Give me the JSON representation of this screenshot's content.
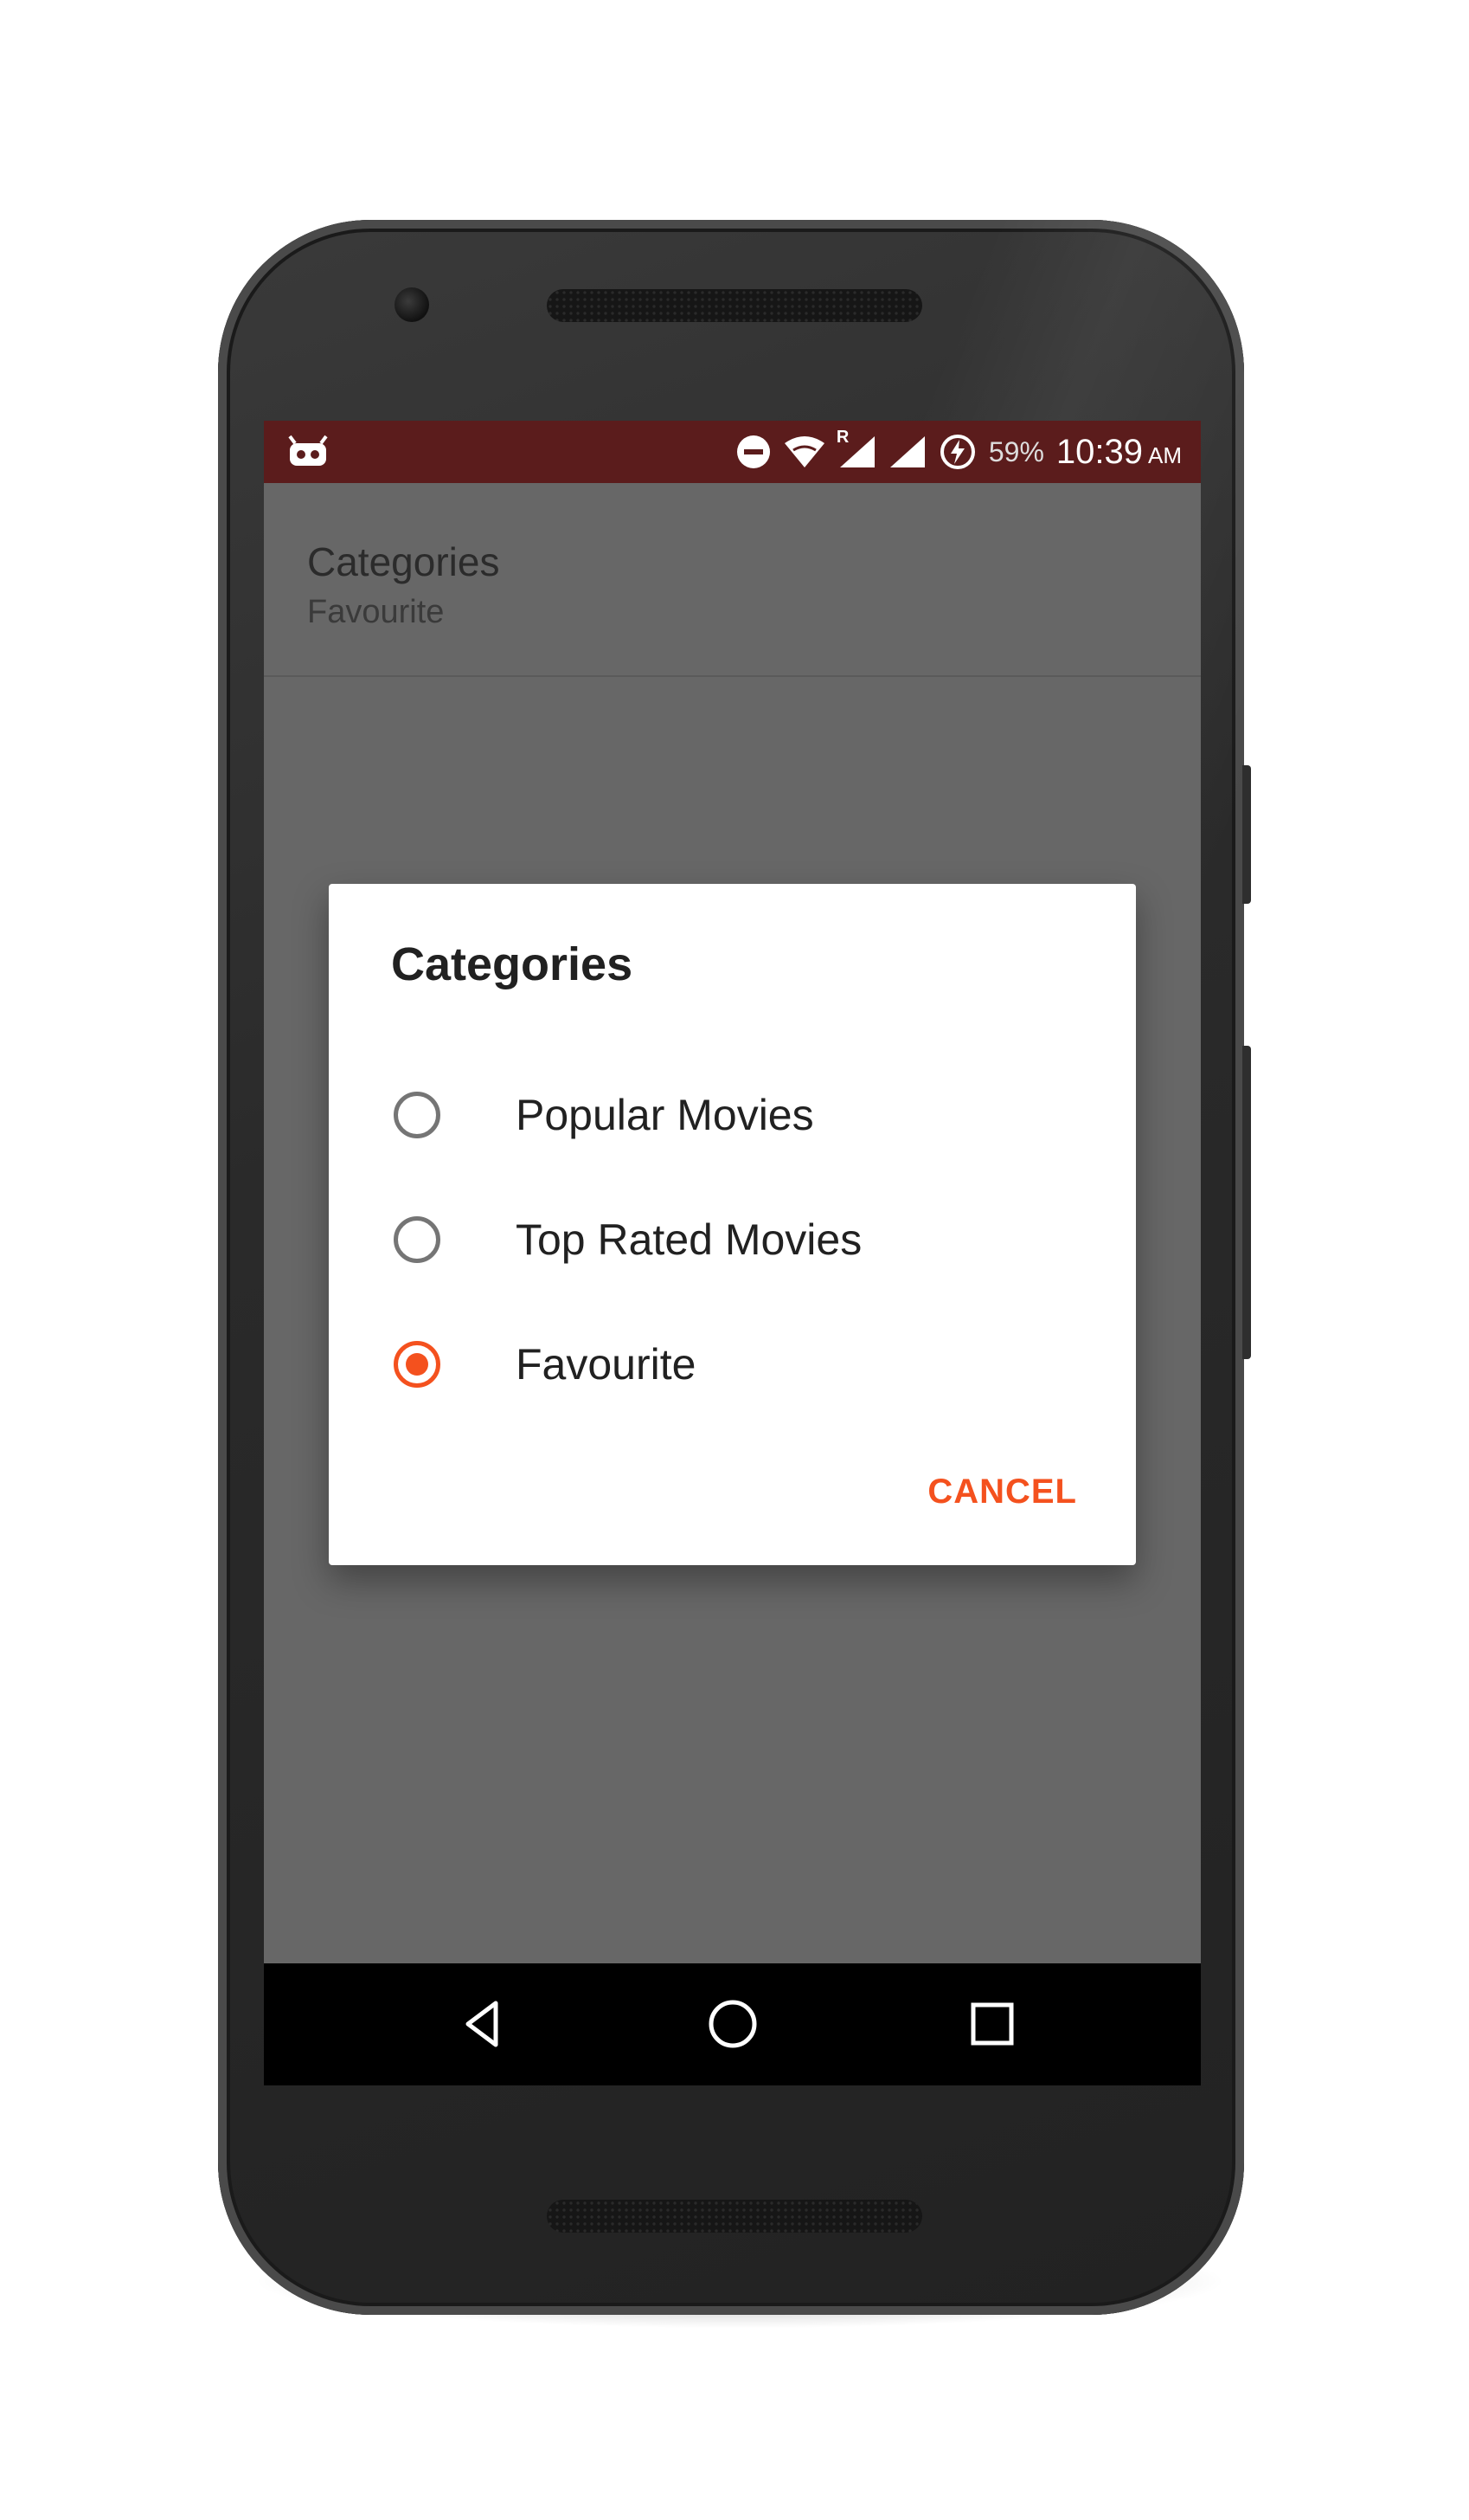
{
  "status_bar": {
    "battery_percent": "59%",
    "time": "10:39",
    "am_pm": "AM",
    "roaming_indicator": "R",
    "icons": [
      "android-debug-icon",
      "do-not-disturb-icon",
      "wifi-icon",
      "signal-icon",
      "signal-icon",
      "battery-charging-icon"
    ]
  },
  "preference": {
    "title": "Categories",
    "summary": "Favourite"
  },
  "dialog": {
    "title": "Categories",
    "options": [
      {
        "label": "Popular Movies",
        "checked": false
      },
      {
        "label": "Top Rated Movies",
        "checked": false
      },
      {
        "label": "Favourite",
        "checked": true
      }
    ],
    "cancel_label": "CANCEL"
  },
  "navigation": {
    "icons": [
      "back-icon",
      "home-icon",
      "recents-icon"
    ]
  },
  "colors": {
    "status_bar": "#5b1c1c",
    "accent": "#f4511e",
    "scrim": "#676767"
  }
}
